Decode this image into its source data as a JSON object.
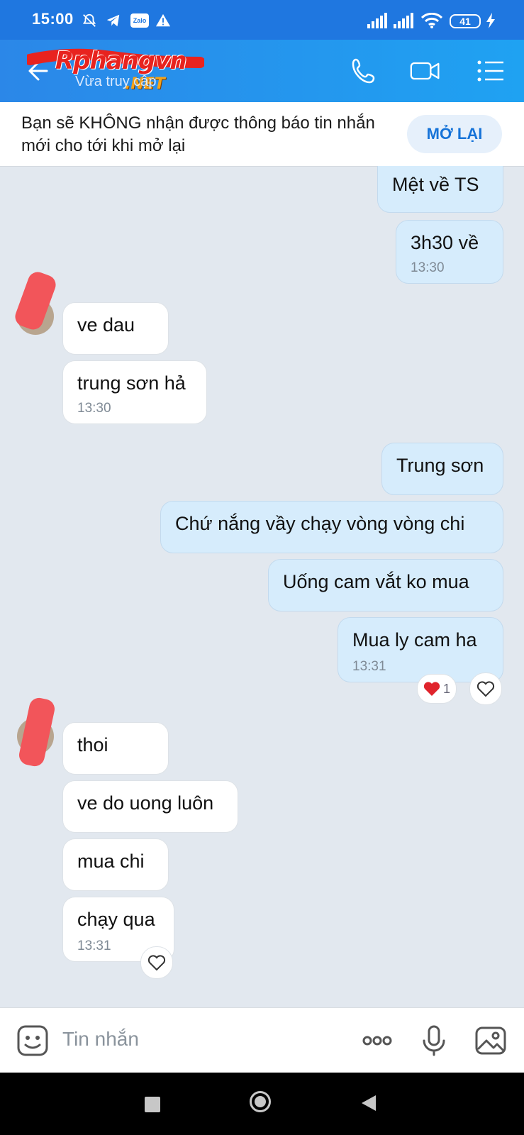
{
  "status_bar": {
    "time": "15:00",
    "battery": "41",
    "icons": [
      "mute-icon",
      "telegram-icon",
      "zalo-icon",
      "warning-icon",
      "signal-icon",
      "signal-icon",
      "wifi-icon",
      "battery-icon",
      "charging-icon"
    ]
  },
  "header": {
    "watermark_logo": "Rphangvn",
    "watermark_net": ".NET",
    "subtitle": "Vừa truy cập",
    "icons": [
      "back-arrow-icon",
      "phone-icon",
      "video-call-icon",
      "menu-icon"
    ]
  },
  "notice": {
    "text": "Bạn sẽ KHÔNG nhận được thông báo tin nhắn mới cho tới khi mở lại",
    "button": "MỞ LẠI"
  },
  "messages": {
    "m1": {
      "text": "Mệt về TS"
    },
    "m2": {
      "text": "3h30 về",
      "time": "13:30"
    },
    "m3": {
      "text": "ve dau"
    },
    "m4": {
      "text": "trung sơn hả",
      "time": "13:30"
    },
    "m5": {
      "text": "Trung sơn"
    },
    "m6": {
      "text": "Chứ nắng vầy chạy vòng vòng chi"
    },
    "m7": {
      "text": "Uống cam vắt ko mua"
    },
    "m8": {
      "text": "Mua ly cam ha",
      "time": "13:31",
      "reaction_count": "1"
    },
    "m9": {
      "text": "thoi"
    },
    "m10": {
      "text": "ve do uong luôn"
    },
    "m11": {
      "text": "mua chi"
    },
    "m12": {
      "text": "chạy qua",
      "time": "13:31"
    }
  },
  "composer": {
    "placeholder": "Tin nhắn",
    "icons": [
      "sticker-icon",
      "more-icon",
      "microphone-icon",
      "image-icon"
    ]
  },
  "nav": {
    "icons": [
      "recent-apps-icon",
      "home-icon",
      "back-icon"
    ]
  },
  "colors": {
    "header": "#1f77e0",
    "outgoing_bubble": "#d6ecfc",
    "incoming_bubble": "#ffffff",
    "background": "#e2e8ef",
    "accent": "#1673d8"
  }
}
